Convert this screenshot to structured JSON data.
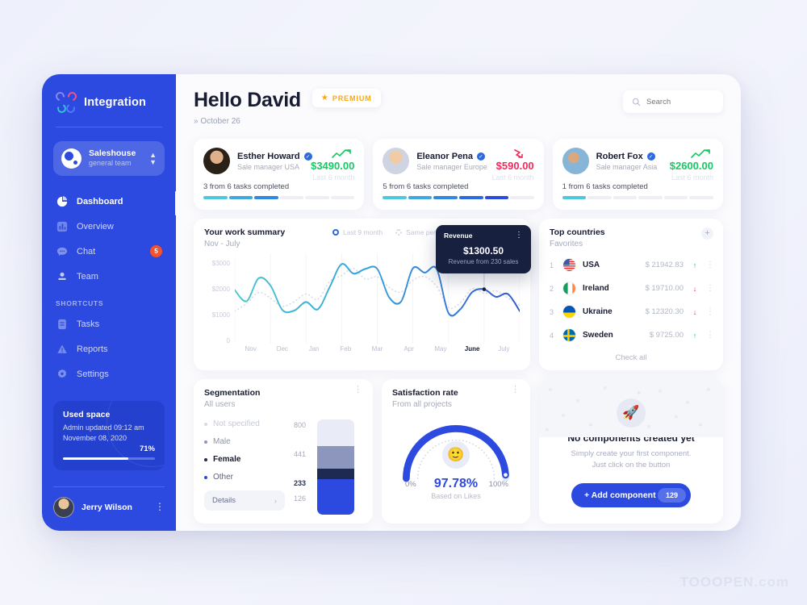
{
  "sidebar": {
    "brand": "Integration",
    "team": {
      "name": "Saleshouse",
      "sub": "general team"
    },
    "nav": [
      {
        "label": "Dashboard",
        "icon": "pie-chart-icon",
        "active": true
      },
      {
        "label": "Overview",
        "icon": "bar-chart-icon",
        "active": false
      },
      {
        "label": "Chat",
        "icon": "chat-icon",
        "badge": "5",
        "active": false
      },
      {
        "label": "Team",
        "icon": "team-icon",
        "active": false
      }
    ],
    "shortcuts_label": "SHORTCUTS",
    "shortcuts": [
      {
        "label": "Tasks",
        "icon": "tasks-icon"
      },
      {
        "label": "Reports",
        "icon": "reports-icon"
      },
      {
        "label": "Settings",
        "icon": "settings-icon"
      }
    ],
    "used_space": {
      "title": "Used space",
      "line1": "Admin updated 09:12 am",
      "line2": "November 08, 2020",
      "percent": "71%",
      "percent_value": 71
    },
    "user": {
      "name": "Jerry Wilson"
    }
  },
  "header": {
    "greeting": "Hello David",
    "badge": "PREMIUM",
    "date": "» October 26",
    "search_placeholder": "Search"
  },
  "people": [
    {
      "name": "Esther Howard",
      "role": "Sale manager USA",
      "amount": "$3490.00",
      "direction": "up",
      "last": "Last 6 month",
      "tasks": "3 from 6 tasks completed",
      "done": 3,
      "total": 6
    },
    {
      "name": "Eleanor Pena",
      "role": "Sale manager Europe",
      "amount": "$590.00",
      "direction": "down",
      "last": "Last 6 month",
      "tasks": "5 from 6 tasks completed",
      "done": 5,
      "total": 6
    },
    {
      "name": "Robert Fox",
      "role": "Sale manager Asia",
      "amount": "$2600.00",
      "direction": "up",
      "last": "Last 6 month",
      "tasks": "1 from 6 tasks completed",
      "done": 1,
      "total": 6
    }
  ],
  "work_summary": {
    "title": "Your work summary",
    "subtitle": "Nov - July",
    "legend": [
      "Last 9 month",
      "Same period in"
    ],
    "help": "?",
    "tooltip": {
      "label": "Revenue",
      "value": "$1300.50",
      "sub": "Revenue from 230 sales"
    }
  },
  "chart_data": {
    "type": "line",
    "title": "Your work summary",
    "subtitle": "Nov - July",
    "xlabel": "",
    "ylabel": "",
    "categories": [
      "Nov",
      "Dec",
      "Jan",
      "Feb",
      "Mar",
      "Apr",
      "May",
      "June",
      "July"
    ],
    "yticks": [
      "0",
      "$1000",
      "$2000",
      "$3000"
    ],
    "ylim": [
      0,
      3400
    ],
    "active_category": "June",
    "grid": false,
    "legend_position": "top-right",
    "series": [
      {
        "name": "Last 9 month",
        "style": "solid",
        "color": "#3aa0d8",
        "values": [
          1980,
          1520,
          2480,
          2180,
          1150,
          1120,
          1480,
          1180,
          2120,
          3080,
          2680,
          2880,
          2880,
          1680,
          1500,
          2900,
          2720,
          2880,
          1020,
          1180,
          1900,
          2020,
          1700,
          1820,
          1100
        ]
      },
      {
        "name": "Same period in",
        "style": "dotted",
        "color": "#d8dbe8",
        "values": [
          1100,
          1420,
          1880,
          1650,
          1300,
          1500,
          1820,
          1600,
          2350,
          2600,
          2900,
          2450,
          2550,
          2100,
          1900,
          2400,
          2550,
          2150,
          1250,
          1450,
          2050,
          1850,
          1950,
          1650,
          1350
        ]
      }
    ],
    "marker": {
      "category": "June",
      "value": 1300.5,
      "label": "$1300.50"
    }
  },
  "top_countries": {
    "title": "Top countries",
    "subtitle": "Favorites",
    "add_icon": "plus-icon",
    "rows": [
      {
        "rank": "1",
        "name": "USA",
        "value": "$ 21942.83",
        "direction": "up",
        "flag": "flag-usa"
      },
      {
        "rank": "2",
        "name": "Ireland",
        "value": "$ 19710.00",
        "direction": "down",
        "flag": "flag-ireland"
      },
      {
        "rank": "3",
        "name": "Ukraine",
        "value": "$ 12320.30",
        "direction": "down",
        "flag": "flag-ukraine"
      },
      {
        "rank": "4",
        "name": "Sweden",
        "value": "$ 9725.00",
        "direction": "up",
        "flag": "flag-sweden"
      }
    ],
    "check_all": "Check all"
  },
  "segmentation": {
    "title": "Segmentation",
    "subtitle": "All users",
    "details_label": "Details",
    "legend": [
      {
        "label": "Not specified",
        "color": "#d7dae6",
        "text_color": "#c6cad8"
      },
      {
        "label": "Male",
        "color": "#8d96bd",
        "text_color": "#8f95a8"
      },
      {
        "label": "Female",
        "color": "#1f2a52",
        "text_color": "#181c32"
      },
      {
        "label": "Other",
        "color": "#2c4ae0",
        "text_color": "#5a6persist"
      }
    ],
    "values": [
      "800",
      "441",
      "233",
      "126"
    ]
  },
  "segmentation_chart": {
    "type": "bar",
    "title": "Segmentation",
    "categories": [
      "Not specified",
      "Male",
      "Female",
      "Other"
    ],
    "values": [
      800,
      441,
      233,
      126
    ],
    "colors": [
      "#e7eaf4",
      "#8d96bd",
      "#1f2a52",
      "#2c4ae0"
    ]
  },
  "satisfaction": {
    "title": "Satisfaction rate",
    "subtitle": "From all projects",
    "percent": "97.78%",
    "percent_value": 97.78,
    "based_on": "Based on Likes",
    "min": "0%",
    "max": "100%",
    "emoji": "smiley-icon"
  },
  "empty_state": {
    "title": "No components created yet",
    "line1": "Simply create your first component.",
    "line2": "Just click on the button",
    "button_label": "+ Add component",
    "button_count": "129",
    "icon": "rocket-icon"
  },
  "watermark": "TOOOPEN.com",
  "colors": {
    "brand_blue": "#2c4ae0",
    "up_green": "#17c964",
    "down_red": "#f3295c",
    "premium_gold": "#ffa511",
    "badge_red": "#f5522d"
  }
}
